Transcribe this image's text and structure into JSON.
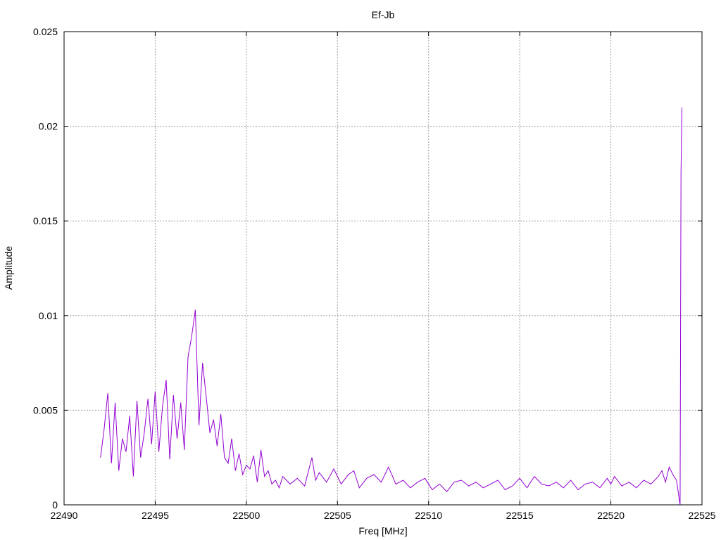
{
  "chart_data": {
    "type": "line",
    "title": "Ef-Jb",
    "xlabel": "Freq [MHz]",
    "ylabel": "Amplitude",
    "xlim": [
      22490,
      22525
    ],
    "ylim": [
      0,
      0.025
    ],
    "xticks": [
      22490,
      22495,
      22500,
      22505,
      22510,
      22515,
      22520,
      22525
    ],
    "yticks": [
      0,
      0.005,
      0.01,
      0.015,
      0.02,
      0.025
    ],
    "ytick_labels": [
      "0",
      "0.005",
      "0.01",
      "0.015",
      "0.02",
      "0.025"
    ],
    "grid": true,
    "line_color": "#9400d3",
    "series": [
      {
        "x": [
          22492.0,
          22492.2,
          22492.4,
          22492.6,
          22492.8,
          22493.0,
          22493.2,
          22493.4,
          22493.6,
          22493.8,
          22494.0,
          22494.2,
          22494.4,
          22494.6,
          22494.8,
          22495.0,
          22495.2,
          22495.4,
          22495.6,
          22495.8,
          22496.0,
          22496.2,
          22496.4,
          22496.6,
          22496.8,
          22497.0,
          22497.2,
          22497.4,
          22497.6,
          22497.8,
          22498.0,
          22498.2,
          22498.4,
          22498.6,
          22498.8,
          22499.0,
          22499.2,
          22499.4,
          22499.6,
          22499.8,
          22500.0,
          22500.2,
          22500.4,
          22500.6,
          22500.8,
          22501.0,
          22501.2,
          22501.4,
          22501.6,
          22501.8,
          22502.0,
          22502.4,
          22502.8,
          22503.2,
          22503.6,
          22503.8,
          22504.0,
          22504.4,
          22504.8,
          22505.2,
          22505.6,
          22505.9,
          22506.2,
          22506.6,
          22507.0,
          22507.4,
          22507.8,
          22508.2,
          22508.6,
          22509.0,
          22509.4,
          22509.8,
          22510.2,
          22510.6,
          22511.0,
          22511.4,
          22511.8,
          22512.2,
          22512.6,
          22513.0,
          22513.4,
          22513.8,
          22514.2,
          22514.6,
          22515.0,
          22515.4,
          22515.8,
          22516.2,
          22516.6,
          22517.0,
          22517.4,
          22517.8,
          22518.2,
          22518.6,
          22519.0,
          22519.4,
          22519.8,
          22520.0,
          22520.2,
          22520.6,
          22521.0,
          22521.4,
          22521.8,
          22522.2,
          22522.6,
          22522.8,
          22523.0,
          22523.2,
          22523.4,
          22523.6,
          22523.8,
          22523.85,
          22523.9
        ],
        "y": [
          0.0025,
          0.004,
          0.0059,
          0.0022,
          0.0054,
          0.0018,
          0.0035,
          0.0028,
          0.0047,
          0.0015,
          0.0055,
          0.0025,
          0.0038,
          0.0056,
          0.0032,
          0.006,
          0.0028,
          0.0052,
          0.0066,
          0.0024,
          0.0058,
          0.0035,
          0.0054,
          0.0029,
          0.0078,
          0.0089,
          0.0103,
          0.0042,
          0.0075,
          0.0057,
          0.0038,
          0.0045,
          0.0031,
          0.0048,
          0.0025,
          0.0022,
          0.0035,
          0.0018,
          0.0027,
          0.0016,
          0.0021,
          0.0019,
          0.0026,
          0.0012,
          0.0029,
          0.0015,
          0.0018,
          0.0011,
          0.0013,
          0.0009,
          0.0015,
          0.0011,
          0.0014,
          0.001,
          0.0025,
          0.0013,
          0.0017,
          0.0012,
          0.0019,
          0.0011,
          0.0016,
          0.0018,
          0.0009,
          0.0014,
          0.0016,
          0.0012,
          0.002,
          0.0011,
          0.0013,
          0.0009,
          0.0012,
          0.0014,
          0.0008,
          0.0011,
          0.0007,
          0.0012,
          0.0013,
          0.001,
          0.0012,
          0.0009,
          0.0011,
          0.0013,
          0.0008,
          0.001,
          0.0014,
          0.0009,
          0.0015,
          0.0011,
          0.001,
          0.0012,
          0.0009,
          0.0013,
          0.0008,
          0.0011,
          0.0012,
          0.0009,
          0.0014,
          0.0011,
          0.0015,
          0.001,
          0.0012,
          0.0009,
          0.0013,
          0.0011,
          0.0015,
          0.0018,
          0.0012,
          0.002,
          0.0016,
          0.0013,
          0.0,
          0.0176,
          0.021
        ]
      }
    ]
  }
}
